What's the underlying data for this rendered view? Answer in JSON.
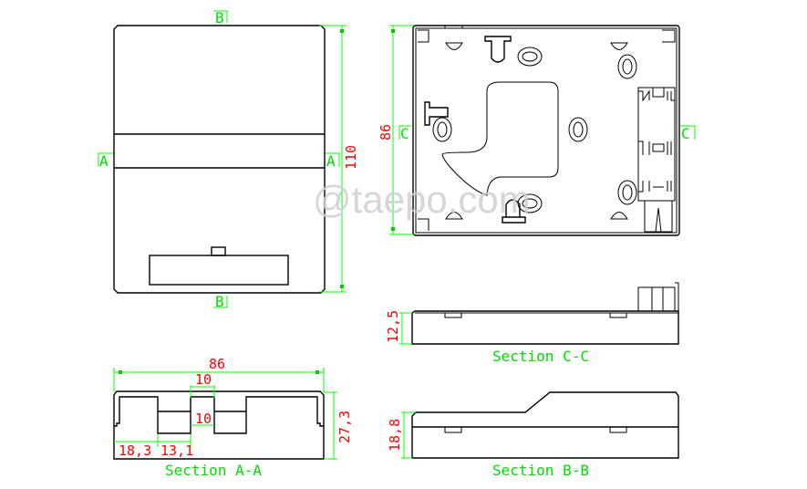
{
  "watermark": "@taepo.com",
  "colors": {
    "outline": "#000000",
    "dimension_line": "#00ff00",
    "dimension_text": "#ff0000",
    "section_label": "#00dd00"
  },
  "views": {
    "front": {
      "section_markers": {
        "top": "B",
        "bottom": "B",
        "left": "A",
        "right": "A"
      },
      "height_dim": "110"
    },
    "back": {
      "section_markers": {
        "left": "C",
        "right": "C"
      },
      "height_dim": "86"
    },
    "section_aa": {
      "title": "Section A-A",
      "width_dim": "86",
      "slot_top_dim": "10",
      "slot_inner_dim": "10",
      "left_offset_dim": "18,3",
      "slot_width_dim": "13,1",
      "height_dim": "27,3"
    },
    "section_cc": {
      "title": "Section C-C",
      "height_dim": "12,5"
    },
    "section_bb": {
      "title": "Section B-B",
      "height_dim": "18,8"
    }
  }
}
